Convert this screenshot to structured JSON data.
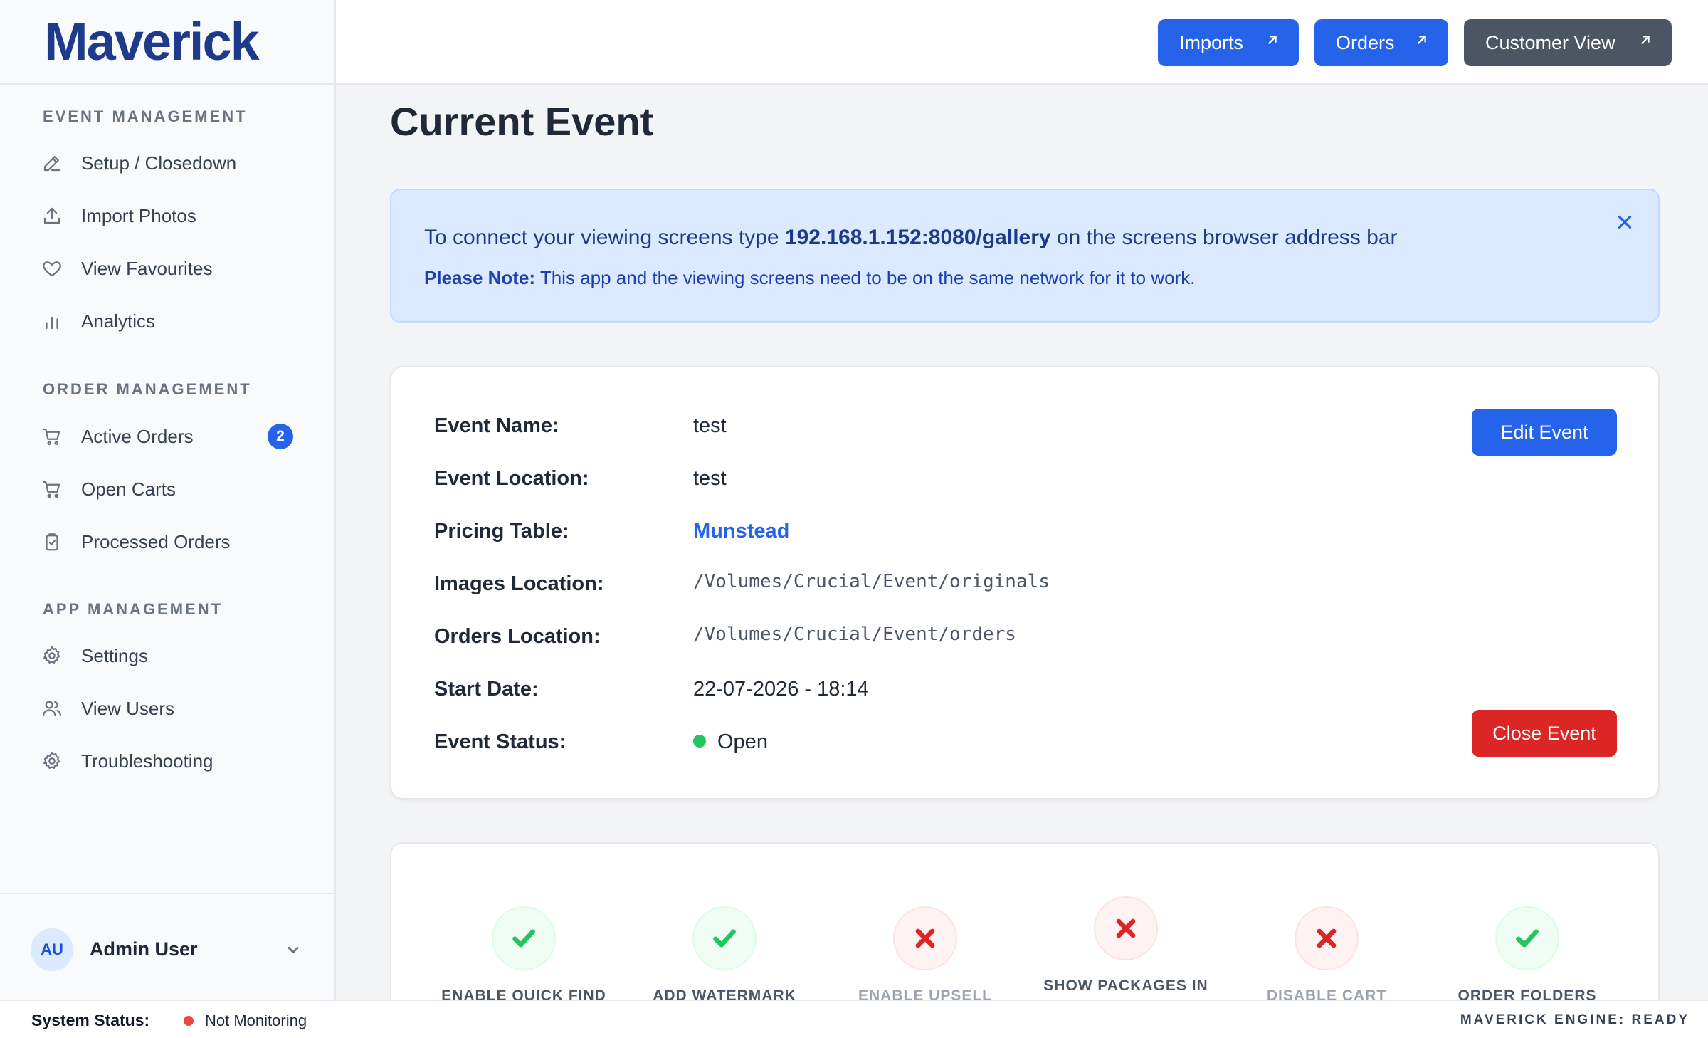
{
  "app": {
    "logo": "Maverick"
  },
  "header": {
    "imports_label": "Imports",
    "orders_label": "Orders",
    "customer_view_label": "Customer View"
  },
  "sidebar": {
    "sections": [
      {
        "title": "EVENT MANAGEMENT",
        "items": [
          {
            "label": "Setup / Closedown",
            "icon": "pencil-icon"
          },
          {
            "label": "Import Photos",
            "icon": "upload-icon"
          },
          {
            "label": "View Favourites",
            "icon": "heart-icon"
          },
          {
            "label": "Analytics",
            "icon": "bar-chart-icon"
          }
        ]
      },
      {
        "title": "ORDER MANAGEMENT",
        "items": [
          {
            "label": "Active Orders",
            "icon": "cart-icon",
            "badge": "2"
          },
          {
            "label": "Open Carts",
            "icon": "cart-icon"
          },
          {
            "label": "Processed Orders",
            "icon": "clipboard-icon"
          }
        ]
      },
      {
        "title": "APP MANAGEMENT",
        "items": [
          {
            "label": "Settings",
            "icon": "gear-icon"
          },
          {
            "label": "View Users",
            "icon": "users-icon"
          },
          {
            "label": "Troubleshooting",
            "icon": "gear-icon"
          }
        ]
      }
    ],
    "user": {
      "initials": "AU",
      "name": "Admin User"
    }
  },
  "main": {
    "title": "Current Event",
    "alert": {
      "prefix": "To connect your viewing screens type ",
      "address": "192.168.1.152:8080/gallery",
      "suffix": " on the screens browser address bar",
      "note_label": "Please Note:",
      "note_text": " This app and the viewing screens need to be on the same network for it to work."
    },
    "event": {
      "rows": [
        {
          "label": "Event Name:",
          "value": "test"
        },
        {
          "label": "Event Location:",
          "value": "test"
        },
        {
          "label": "Pricing Table:",
          "value": "Munstead"
        },
        {
          "label": "Images Location:",
          "value": "/Volumes/Crucial/Event/originals"
        },
        {
          "label": "Orders Location:",
          "value": "/Volumes/Crucial/Event/orders"
        },
        {
          "label": "Start Date:",
          "value": "22-07-2026 - 18:14"
        },
        {
          "label": "Event Status:",
          "value": "Open"
        }
      ],
      "edit_label": "Edit Event",
      "close_label": "Close Event",
      "status_color": "#22c55e"
    },
    "features": [
      {
        "label": "ENABLE QUICK FIND",
        "enabled": true
      },
      {
        "label": "ADD WATERMARK",
        "enabled": true
      },
      {
        "label": "ENABLE UPSELL",
        "enabled": false
      },
      {
        "label": "SHOW PACKAGES IN",
        "enabled": false
      },
      {
        "label": "DISABLE CART",
        "enabled": false
      },
      {
        "label": "ORDER FOLDERS",
        "enabled": true
      }
    ]
  },
  "statusbar": {
    "label": "System Status:",
    "value": "Not Monitoring",
    "right": "MAVERICK ENGINE: READY"
  },
  "colors": {
    "primary": "#2563eb",
    "danger": "#dc2626",
    "success": "#22c55e",
    "brand": "#1e3a8a"
  }
}
